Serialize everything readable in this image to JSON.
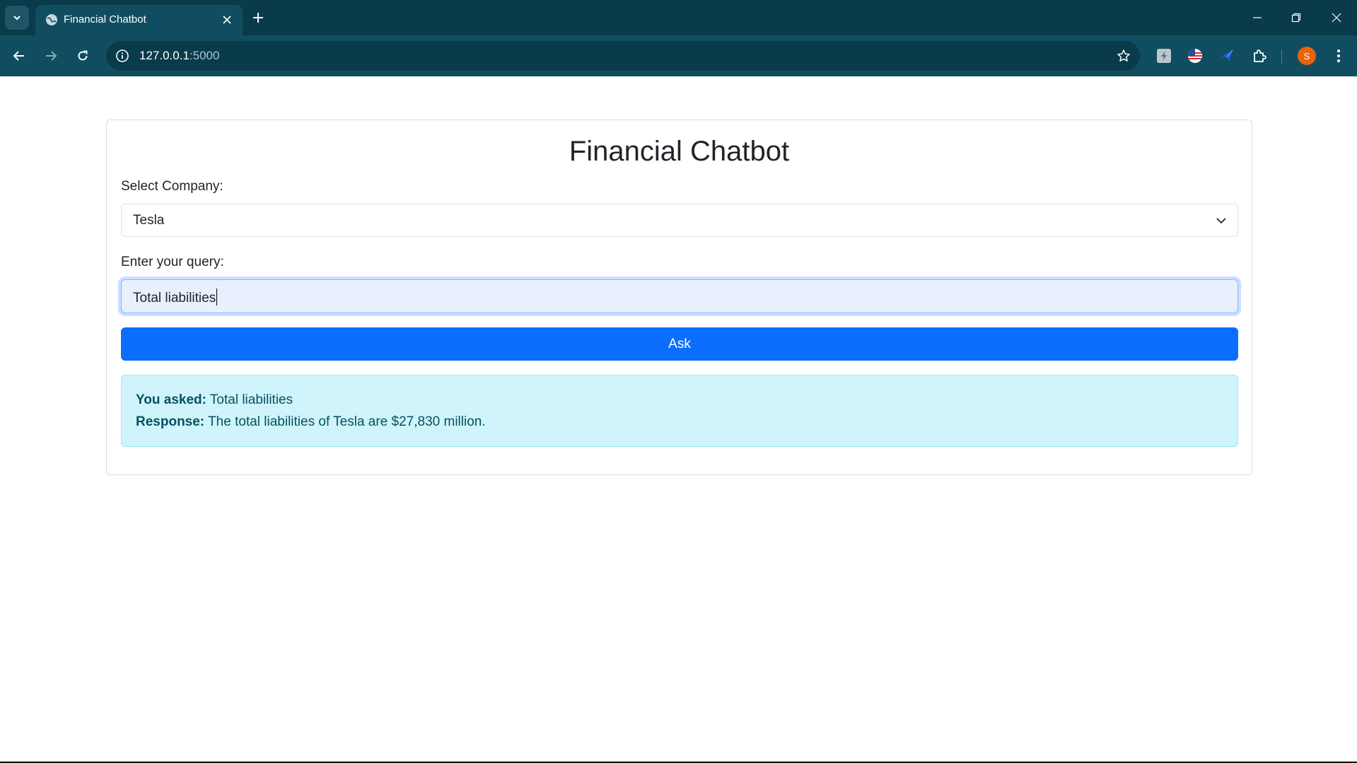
{
  "browser": {
    "tab_title": "Financial Chatbot",
    "url_host": "127.0.0.1",
    "url_port": ":5000",
    "profile_initial": "S"
  },
  "icons": {
    "tab_search": "chevron-down-icon",
    "favicon": "globe-icon",
    "tab_close": "close-icon",
    "new_tab": "plus-icon",
    "back": "arrow-left-icon",
    "forward": "arrow-right-icon",
    "reload": "reload-icon",
    "site_info": "info-icon",
    "bookmark": "star-icon",
    "extensions": "puzzle-icon",
    "menu": "kebab-menu-icon"
  },
  "colors": {
    "chrome_dark": "#093b4b",
    "chrome_toolbar": "#104d60",
    "primary_button": "#0d6efd",
    "alert_bg": "#cff4fc",
    "alert_text": "#055160",
    "avatar": "#e8630a"
  },
  "page": {
    "title": "Financial Chatbot",
    "company_label": "Select Company:",
    "company_selected": "Tesla",
    "query_label": "Enter your query:",
    "query_value": "Total liabilities",
    "ask_label": "Ask",
    "result": {
      "asked_label": "You asked:",
      "asked_value": "Total liabilities",
      "response_label": "Response:",
      "response_value": "The total liabilities of Tesla are $27,830 million."
    }
  }
}
